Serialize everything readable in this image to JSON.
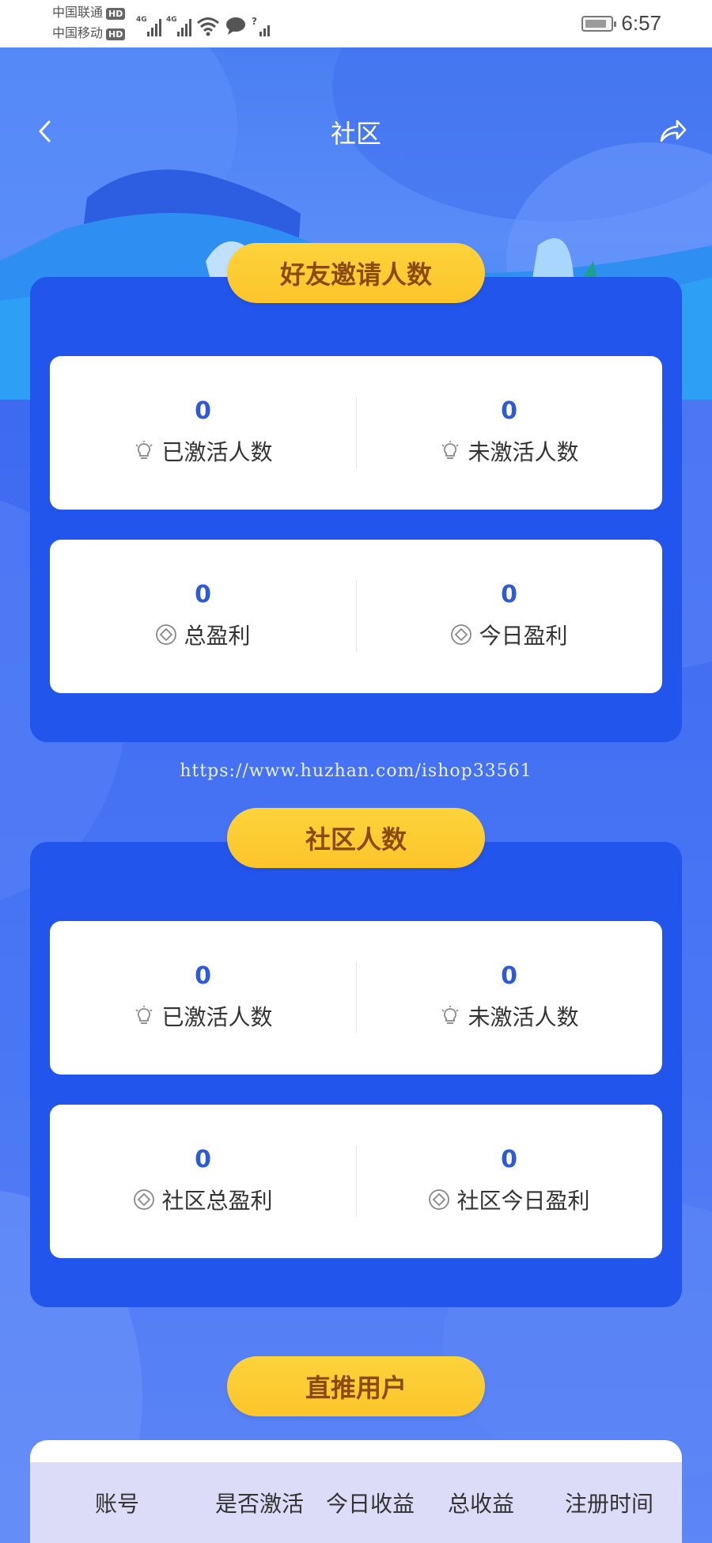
{
  "status_bar": {
    "carrier1": "中国联通",
    "carrier2": "中国移动",
    "hd": "HD",
    "net1": "4G",
    "net2": "4G",
    "net3": "?",
    "time": "6:57"
  },
  "nav": {
    "title": "社区",
    "back_icon": "chevron-left-icon",
    "share_icon": "share-icon"
  },
  "friends_section": {
    "title": "好友邀请人数",
    "cards": [
      [
        {
          "value": "0",
          "label": "已激活人数",
          "icon": "lightbulb-icon"
        },
        {
          "value": "0",
          "label": "未激活人数",
          "icon": "lightbulb-icon"
        }
      ],
      [
        {
          "value": "0",
          "label": "总盈利",
          "icon": "diamond-coin-icon"
        },
        {
          "value": "0",
          "label": "今日盈利",
          "icon": "diamond-coin-icon"
        }
      ]
    ]
  },
  "watermark": "https://www.huzhan.com/ishop33561",
  "community_section": {
    "title": "社区人数",
    "cards": [
      [
        {
          "value": "0",
          "label": "已激活人数",
          "icon": "lightbulb-icon"
        },
        {
          "value": "0",
          "label": "未激活人数",
          "icon": "lightbulb-icon"
        }
      ],
      [
        {
          "value": "0",
          "label": "社区总盈利",
          "icon": "diamond-coin-icon"
        },
        {
          "value": "0",
          "label": "社区今日盈利",
          "icon": "diamond-coin-icon"
        }
      ]
    ]
  },
  "direct_section": {
    "title": "直推用户",
    "columns": [
      "账号",
      "是否激活",
      "今日收益",
      "总收益",
      "注册时间"
    ]
  },
  "colors": {
    "background": "#3f6ef2",
    "panel": "#2255ec",
    "pill": "#fcc52a",
    "pill_text": "#8a4a10",
    "value_text": "#2d5bd6",
    "table_header": "#dcdcf8"
  }
}
